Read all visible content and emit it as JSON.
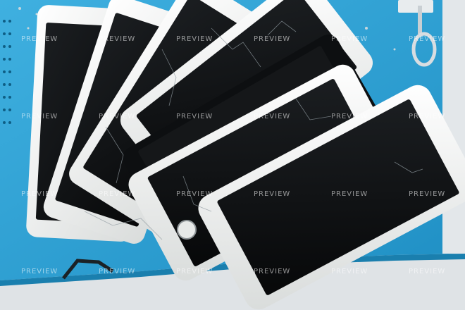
{
  "watermark": {
    "text": "PREVIEW"
  },
  "colors": {
    "mat": "#2ea3d6",
    "mat_dark": "#1f86b5",
    "floor": "#dfe3e6",
    "phone_frame": "#f2f3f1",
    "screen": "#111315",
    "crack": "#9aa4aa"
  }
}
